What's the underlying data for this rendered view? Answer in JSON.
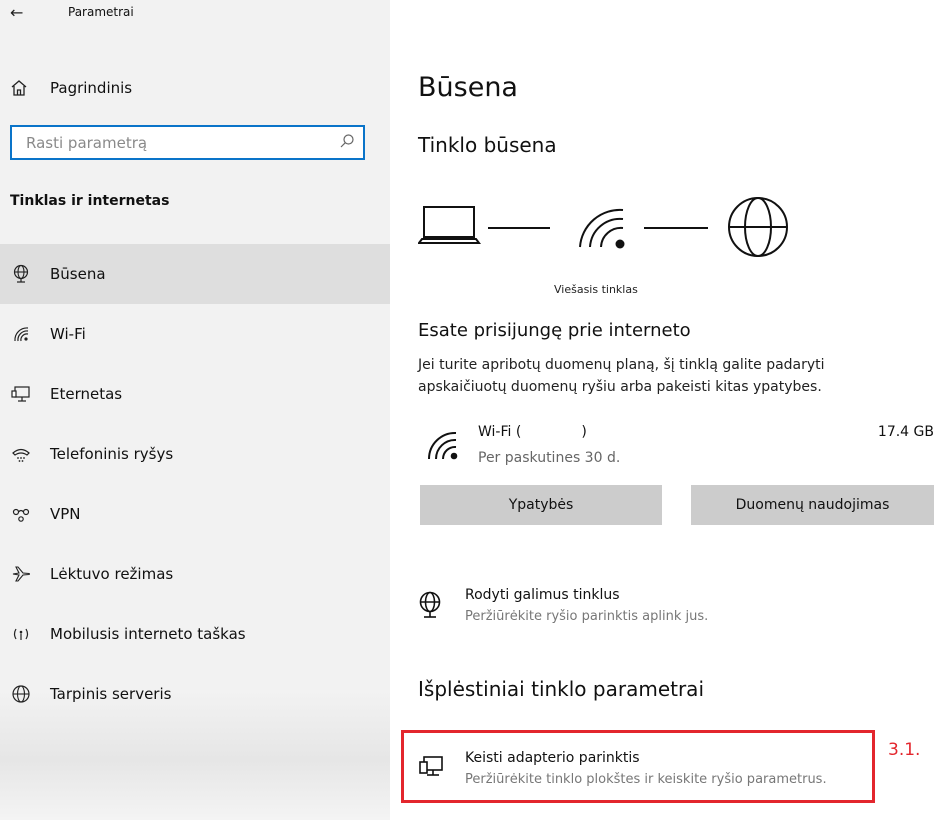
{
  "window": {
    "title": "Parametrai"
  },
  "sidebar": {
    "home_label": "Pagrindinis",
    "search_placeholder": "Rasti parametrą",
    "section_title": "Tinklas ir internetas",
    "items": [
      {
        "label": "Būsena",
        "icon": "network-status-icon",
        "active": true
      },
      {
        "label": "Wi-Fi",
        "icon": "wifi-icon"
      },
      {
        "label": "Eternetas",
        "icon": "ethernet-icon"
      },
      {
        "label": "Telefoninis ryšys",
        "icon": "dialup-icon"
      },
      {
        "label": "VPN",
        "icon": "vpn-icon"
      },
      {
        "label": "Lėktuvo režimas",
        "icon": "airplane-icon"
      },
      {
        "label": "Mobilusis interneto taškas",
        "icon": "hotspot-icon"
      },
      {
        "label": "Tarpinis serveris",
        "icon": "proxy-globe-icon"
      }
    ]
  },
  "main": {
    "page_title": "Būsena",
    "network_status_title": "Tinklo būsena",
    "network_type": "Viešasis tinklas",
    "connected_title": "Esate prisijungę prie interneto",
    "connected_desc": "Jei turite apribotų duomenų planą, šį tinklą galite padaryti apskaičiuotų duomenų ryšiu arba pakeisti kitas ypatybes.",
    "connection": {
      "name": "Wi-Fi (",
      "name_end": ")",
      "period": "Per paskutines 30 d.",
      "usage": "17.4 GB"
    },
    "properties_button": "Ypatybės",
    "data_usage_button": "Duomenų naudojimas",
    "show_networks": {
      "title": "Rodyti galimus tinklus",
      "desc": "Peržiūrėkite ryšio parinktis aplink jus."
    },
    "advanced_title": "Išplėstiniai tinklo parametrai",
    "change_adapter": {
      "title": "Keisti adapterio parinktis",
      "desc": "Peržiūrėkite tinklo plokštes ir keiskite ryšio parametrus."
    },
    "step_label": "3.1."
  },
  "colors": {
    "accent": "#0a74c9",
    "highlight": "#e3262d",
    "sidebar_bg": "#f2f2f2",
    "active_item": "#dedede",
    "button_bg": "#cccccc"
  }
}
